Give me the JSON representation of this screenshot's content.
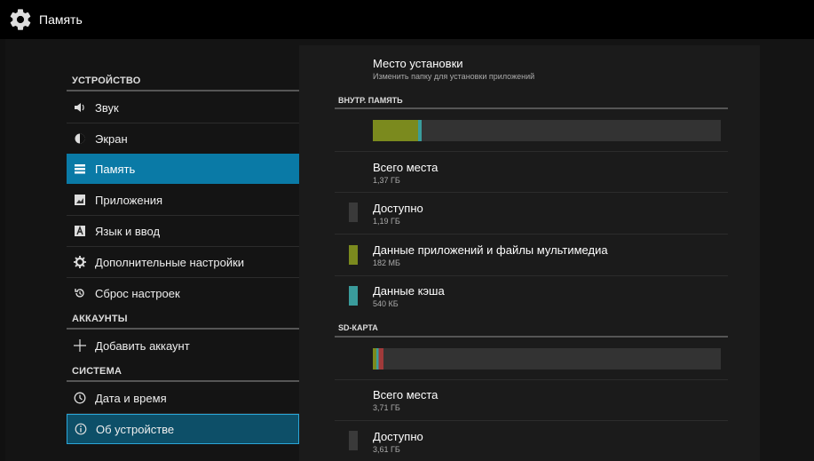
{
  "titlebar": {
    "title": "Память",
    "icon": "gear-icon"
  },
  "sidebar": {
    "sections": [
      {
        "header": "УСТРОЙСТВО"
      },
      {
        "header": "АККАУНТЫ"
      },
      {
        "header": "СИСТЕМА"
      }
    ],
    "items": [
      {
        "label": "Звук",
        "icon": "volume-icon"
      },
      {
        "label": "Экран",
        "icon": "brightness-icon"
      },
      {
        "label": "Память",
        "icon": "storage-icon"
      },
      {
        "label": "Приложения",
        "icon": "apps-icon"
      },
      {
        "label": "Язык и ввод",
        "icon": "language-icon"
      },
      {
        "label": "Дополнительные настройки",
        "icon": "gear-icon"
      },
      {
        "label": "Сброс настроек",
        "icon": "reset-icon"
      },
      {
        "label": "Добавить аккаунт",
        "icon": "plus-icon"
      },
      {
        "label": "Дата и время",
        "icon": "clock-icon"
      },
      {
        "label": "Об устройстве",
        "icon": "info-icon"
      }
    ],
    "selected": "Память"
  },
  "main": {
    "install": {
      "title": "Место установки",
      "subtitle": "Изменить папку для установки приложений"
    },
    "internal": {
      "header": "ВНУТР. ПАМЯТЬ",
      "bar": {
        "apps_fraction": 0.13,
        "cache_fraction": 0.01,
        "color_apps": "#7b8a1e",
        "color_cache": "#3a9c9c"
      },
      "total": {
        "title": "Всего места",
        "value": "1,37 ГБ"
      },
      "available": {
        "title": "Доступно",
        "value": "1,19 ГБ",
        "color": "#3a3a3a"
      },
      "apps": {
        "title": "Данные приложений и файлы мультимедиа",
        "value": "182 МБ",
        "color": "#7b8a1e"
      },
      "cache": {
        "title": "Данные кэша",
        "value": "540 КБ",
        "color": "#3a9c9c"
      }
    },
    "sd": {
      "header": "SD-КАРТА",
      "bar": {
        "used_fraction": 0.03
      },
      "total": {
        "title": "Всего места",
        "value": "3,71 ГБ"
      },
      "available": {
        "title": "Доступно",
        "value": "3,61 ГБ",
        "color": "#3a3a3a"
      }
    }
  }
}
